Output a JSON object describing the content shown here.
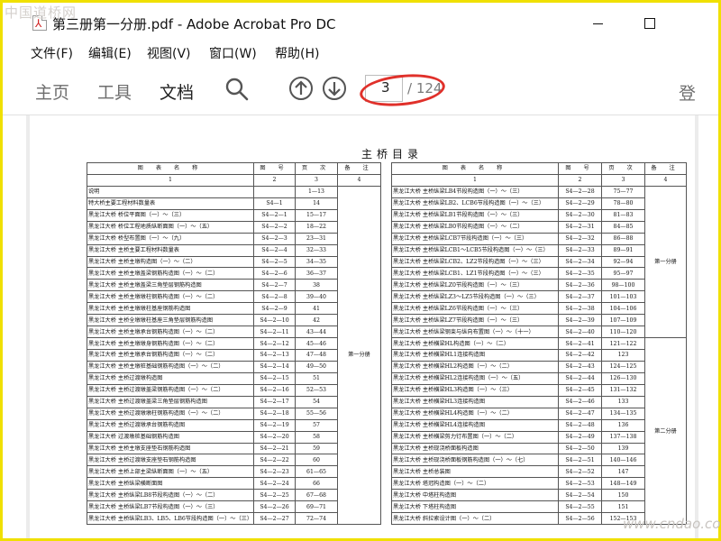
{
  "watermark_top": "中国道桥网",
  "watermark_bottom": "www.cndao.com",
  "window": {
    "title": "第三册第一分册.pdf - Adobe Acrobat Pro DC"
  },
  "menu": [
    "文件(F)",
    "编辑(E)",
    "视图(V)",
    "窗口(W)",
    "帮助(H)"
  ],
  "tabs": [
    {
      "label": "主页",
      "active": false
    },
    {
      "label": "工具",
      "active": false
    },
    {
      "label": "文档",
      "active": true
    }
  ],
  "right_tab": "登",
  "pager": {
    "current": "3",
    "total": "/ 124"
  },
  "colors": {
    "highlight": "#e0302a",
    "frame": "#f0e000"
  },
  "icons": {
    "search": "search-icon",
    "prev": "arrow-up-circle-icon",
    "next": "arrow-down-circle-icon"
  },
  "document": {
    "title": "主桥目录",
    "columns": [
      "图 表 名 称",
      "图 号",
      "页 次",
      "备 注"
    ],
    "col_numbers": [
      "1",
      "2",
      "3",
      "4"
    ],
    "left_note": "第一分册",
    "right_note_1": "第一分册",
    "right_note_2": "第二分册",
    "left_rows": [
      [
        "说明",
        "",
        "1—13"
      ],
      [
        "特大桥主要工程材料数量表",
        "S4—1",
        "14"
      ],
      [
        "黑龙江大桥 桥位平面图（一）～（三）",
        "S4—2—1",
        "15—17"
      ],
      [
        "黑龙江大桥 桥位工程地质纵断面图（一）～（五）",
        "S4—2—2",
        "18—22"
      ],
      [
        "黑龙江大桥 桥型布置图（一）～（九）",
        "S4—2—3",
        "23—31"
      ],
      [
        "黑龙江大桥 主桥主要工程材料数量表",
        "S4—2—4",
        "32—33"
      ],
      [
        "黑龙江大桥 主桥主墩构造图（一）～（二）",
        "S4—2—5",
        "34—35"
      ],
      [
        "黑龙江大桥 主桥主墩盖梁钢筋构造图（一）～（二）",
        "S4—2—6",
        "36—37"
      ],
      [
        "黑龙江大桥 主桥主墩盖梁三角垫层钢筋构造图",
        "S4—2—7",
        "38"
      ],
      [
        "黑龙江大桥 主桥主墩墩柱钢筋构造图（一）～（二）",
        "S4—2—8",
        "39—40"
      ],
      [
        "黑龙江大桥 主桥主墩墩柱基座钢筋构造图",
        "S4—2—9",
        "41"
      ],
      [
        "黑龙江大桥 主桥全墩墩柱基座三角垫层钢筋构造图",
        "S4—2—10",
        "42"
      ],
      [
        "黑龙江大桥 主桥主墩承台钢筋构造图（一）～（二）",
        "S4—2—11",
        "43—44"
      ],
      [
        "黑龙江大桥 主桥主墩墩身钢筋构造图（一）～（二）",
        "S4—2—12",
        "45—46"
      ],
      [
        "黑龙江大桥 主桥主墩承台钢筋构造图（一）～（二）",
        "S4—2—13",
        "47—48"
      ],
      [
        "黑龙江大桥 主桥主墩桩基础钢筋构造图（一）～（二）",
        "S4—2—14",
        "49—50"
      ],
      [
        "黑龙江大桥 主桥过渡墩构造图",
        "S4—2—15",
        "51"
      ],
      [
        "黑龙江大桥 主桥过渡墩盖梁钢筋构造图（一）～（二）",
        "S4—2—16",
        "52—53"
      ],
      [
        "黑龙江大桥 主桥过渡墩盖梁三角垫层钢筋构造图",
        "S4—2—17",
        "54"
      ],
      [
        "黑龙江大桥 主桥过渡墩墩柱钢筋构造图（一）～（二）",
        "S4—2—18",
        "55—56"
      ],
      [
        "黑龙江大桥 主桥过渡墩承台钢筋构造图",
        "S4—2—19",
        "57"
      ],
      [
        "黑龙江大桥 过渡墩桩基础钢筋构造图",
        "S4—2—20",
        "58"
      ],
      [
        "黑龙江大桥 主桥主墩支座垫石钢筋构造图",
        "S4—2—21",
        "59"
      ],
      [
        "黑龙江大桥 主桥过渡墩支座垫石钢筋构造图",
        "S4—2—22",
        "60"
      ],
      [
        "黑龙江大桥 主桥上部主梁纵断面图（一）～（五）",
        "S4—2—23",
        "61—65"
      ],
      [
        "黑龙江大桥 主桥纵梁横断面图",
        "S4—2—24",
        "66"
      ],
      [
        "黑龙江大桥 主桥纵梁LB8节段构造图（一）～（二）",
        "S4—2—25",
        "67—68"
      ],
      [
        "黑龙江大桥 主桥纵梁LB7节段构造图（一）～（三）",
        "S4—2—26",
        "69—71"
      ],
      [
        "黑龙江大桥 主桥纵梁LB3、LB5、LB6节段构造图（一）～（三）",
        "S4—2—27",
        "72—74"
      ]
    ],
    "right_rows": [
      [
        "黑龙江大桥 主桥纵梁LB4节段构造图（一）～（三）",
        "S4—2—28",
        "75—77"
      ],
      [
        "黑龙江大桥 主桥纵梁LB2、LCB6节段构造图（一）～（三）",
        "S4—2—29",
        "78—80"
      ],
      [
        "黑龙江大桥 主桥纵梁LB1节段构造图（一）～（三）",
        "S4—2—30",
        "81—83"
      ],
      [
        "黑龙江大桥 主桥纵梁LB0节段构造图（一）～（二）",
        "S4—2—31",
        "84—85"
      ],
      [
        "黑龙江大桥 主桥纵梁LCB7节段构造图（一）～（三）",
        "S4—2—32",
        "86—88"
      ],
      [
        "黑龙江大桥 主桥纵梁LCB1～LCB5节段构造图（一）～（三）",
        "S4—2—33",
        "89—91"
      ],
      [
        "黑龙江大桥 主桥纵梁LCB2、LZ2节段构造图（一）～（三）",
        "S4—2—34",
        "92—94"
      ],
      [
        "黑龙江大桥 主桥纵梁LCB1、LZ1节段构造图（一）～（三）",
        "S4—2—35",
        "95—97"
      ],
      [
        "黑龙江大桥 主桥纵梁LZ0节段构造图（一）～（三）",
        "S4—2—36",
        "98—100"
      ],
      [
        "黑龙江大桥 主桥纵梁LZ3～LZ5节段构造图（一）～（三）",
        "S4—2—37",
        "101—103"
      ],
      [
        "黑龙江大桥 主桥纵梁LZ6节段构造图（一）～（三）",
        "S4—2—38",
        "104—106"
      ],
      [
        "黑龙江大桥 主桥纵梁LZ7节段构造图（一）～（三）",
        "S4—2—39",
        "107—109"
      ],
      [
        "黑龙江大桥 主桥纵梁钢束与纵向布置图（一）～（十一）",
        "S4—2—40",
        "110—120"
      ],
      [
        "黑龙江大桥 主桥横梁HL构造图（一）～（二）",
        "S4—2—41",
        "121—122"
      ],
      [
        "黑龙江大桥 主桥横梁HL1连接构造图",
        "S4—2—42",
        "123"
      ],
      [
        "黑龙江大桥 主桥横梁HL2构造图（一）～（二）",
        "S4—2—43",
        "124—125"
      ],
      [
        "黑龙江大桥 主桥横梁HL2连接构造图（一）～（五）",
        "S4—2—44",
        "126—130"
      ],
      [
        "黑龙江大桥 主桥横梁HL3构造图（一）～（三）",
        "S4—2—45",
        "131—132"
      ],
      [
        "黑龙江大桥 主桥横梁HL3连接构造图",
        "S4—2—46",
        "133"
      ],
      [
        "黑龙江大桥 主桥横梁HL4构造图（一）～（二）",
        "S4—2—47",
        "134—135"
      ],
      [
        "黑龙江大桥 主桥横梁HL4连接构造图",
        "S4—2—48",
        "136"
      ],
      [
        "黑龙江大桥 主桥横梁剪力钉布置图（一）～（二）",
        "S4—2—49",
        "137—138"
      ],
      [
        "黑龙江大桥 主桥现浇桥面板构造图",
        "S4—2—50",
        "139"
      ],
      [
        "黑龙江大桥 主桥现浇桥面板钢筋构造图（一）～（七）",
        "S4—2—51",
        "140—146"
      ],
      [
        "黑龙江大桥 主桥总装图",
        "S4—2—52",
        "147"
      ],
      [
        "黑龙江大桥 塔冠构造图（一）～（二）",
        "S4—2—53",
        "148—149"
      ],
      [
        "黑龙江大桥 中塔柱构造图",
        "S4—2—54",
        "150"
      ],
      [
        "黑龙江大桥 下塔柱构造图",
        "S4—2—55",
        "151"
      ],
      [
        "黑龙江大桥 斜拉索设计图（一）～（二）",
        "S4—2—56",
        "152—153"
      ]
    ]
  }
}
